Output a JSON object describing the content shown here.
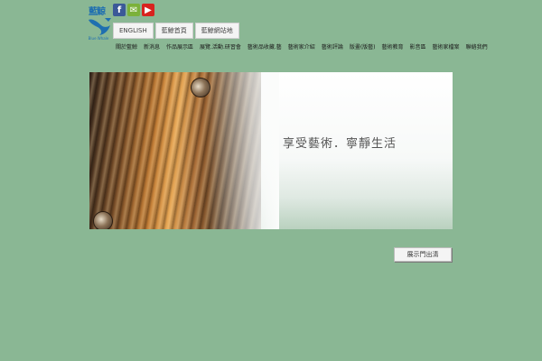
{
  "logo": {
    "title": "藍鯨",
    "subtitle": "Blue Whale"
  },
  "social": [
    {
      "name": "facebook-icon",
      "glyph": "f",
      "color": "#3b5998"
    },
    {
      "name": "mail-icon",
      "glyph": "✉",
      "color": "#7bb13a"
    },
    {
      "name": "youtube-icon",
      "glyph": "▶",
      "color": "#d8231f"
    }
  ],
  "lang_buttons": [
    "ENGLISH",
    "藍鯨首頁",
    "藍鯨網站地"
  ],
  "nav": [
    "關於藍鯨",
    "新消息",
    "作品展示區",
    "展覽.活動.研習會",
    "藝術品收藏.藝",
    "藝術家介紹",
    "藝術評論",
    "版畫(版藝)",
    "藝術教育",
    "影音區",
    "藝術家檔案",
    "聯絡我們"
  ],
  "hero": {
    "slogan": "享受藝術．寧靜生活"
  },
  "exhibit_button": "展示門出清"
}
